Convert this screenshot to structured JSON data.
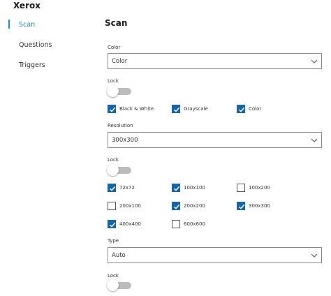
{
  "app": {
    "title": "Xerox"
  },
  "nav": {
    "items": [
      {
        "label": "Scan",
        "active": true
      },
      {
        "label": "Questions",
        "active": false
      },
      {
        "label": "Triggers",
        "active": false
      }
    ]
  },
  "page": {
    "title": "Scan"
  },
  "color": {
    "label": "Color",
    "value": "Color",
    "lock_label": "Lock",
    "lock_on": false,
    "options": [
      {
        "label": "Black & White",
        "checked": true
      },
      {
        "label": "Grayscale",
        "checked": true
      },
      {
        "label": "Color",
        "checked": true
      }
    ]
  },
  "resolution": {
    "label": "Resolution",
    "value": "300x300",
    "lock_label": "Lock",
    "lock_on": false,
    "options": [
      {
        "label": "72x72",
        "checked": true
      },
      {
        "label": "100x100",
        "checked": true
      },
      {
        "label": "100x200",
        "checked": false
      },
      {
        "label": "200x100",
        "checked": false
      },
      {
        "label": "200x200",
        "checked": true
      },
      {
        "label": "300x300",
        "checked": true
      },
      {
        "label": "400x400",
        "checked": true
      },
      {
        "label": "600x600",
        "checked": false
      }
    ]
  },
  "type": {
    "label": "Type",
    "value": "Auto",
    "lock_label": "Lock",
    "lock_on": false
  },
  "icons": {
    "dropdown": "chevron-down-icon",
    "check": "checkmark-icon"
  },
  "colors": {
    "accent": "#1f8fc8",
    "checkbox": "#1565a8",
    "toggle_track": "#bcbcbc"
  }
}
